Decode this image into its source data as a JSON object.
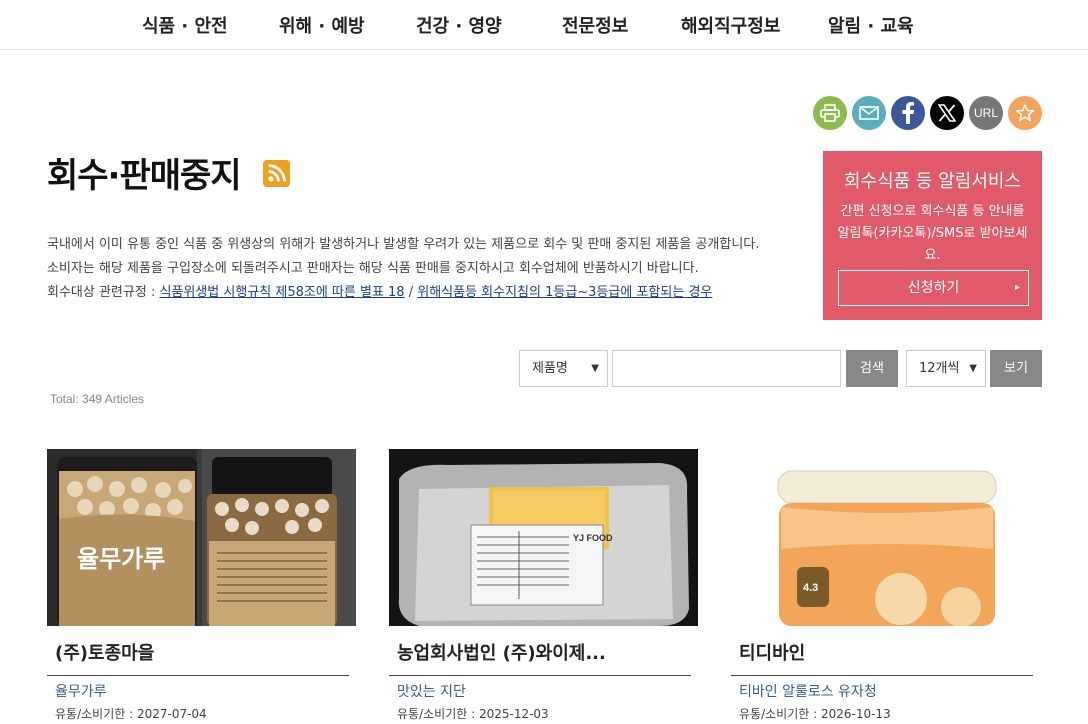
{
  "nav": {
    "items": [
      "식품 · 안전",
      "위해 · 예방",
      "건강 · 영양",
      "전문정보",
      "해외직구정보",
      "알림 · 교육"
    ]
  },
  "share": {
    "url_label": "URL",
    "colors": {
      "print": "#8dbb4e",
      "mail": "#5aaebb",
      "facebook": "#3b5998",
      "x": "#000000",
      "url": "#777777",
      "favorite": "#f2a35e"
    }
  },
  "page": {
    "title": "회수·판매중지",
    "desc1": "국내에서 이미 유통 중인 식품 중 위생상의 위해가 발생하거나 발생할 우려가 있는 제품으로 회수 및 판매 중지된 제품을 공개합니다.",
    "desc2": "소비자는 해당 제품을 구입장소에 되돌려주시고 판매자는 해당 식품 판매를 중지하시고 회수업체에 반품하시기 바랍니다.",
    "desc3_prefix": "회수대상 관련규정 : ",
    "desc3_link1": "식품위생법 시행규칙 제58조에 따른 별표 18",
    "desc3_sep": " / ",
    "desc3_link2": "위해식품등 회수지침의 1등급~3등급에 포함되는 경우"
  },
  "notice": {
    "title": "회수식품 등 알림서비스",
    "body": "간편 신청으로 회수식품 등 안내를 알림톡(카카오톡)/SMS로 받아보세요.",
    "button": "신청하기",
    "color": "#e05a6a"
  },
  "search": {
    "field_select": "제품명",
    "input_value": "",
    "search_button": "검색",
    "count_select": "12개씩",
    "view_button": "보기"
  },
  "total": "Total: 349 Articles",
  "cards": [
    {
      "company": "(주)토종마을",
      "product": "율무가루",
      "date": "유통/소비기한 : 2027-07-04",
      "img_label": "율무가루"
    },
    {
      "company": "농업회사법인 (주)와이제...",
      "product": "맛있는 지단",
      "date": "유통/소비기한 : 2025-12-03",
      "img_label": "YJ FOOD"
    },
    {
      "company": "티디바인",
      "product": "티바인 알룰로스 유자청",
      "date": "유통/소비기한 : 2026-10-13",
      "img_label": "4.3"
    }
  ]
}
